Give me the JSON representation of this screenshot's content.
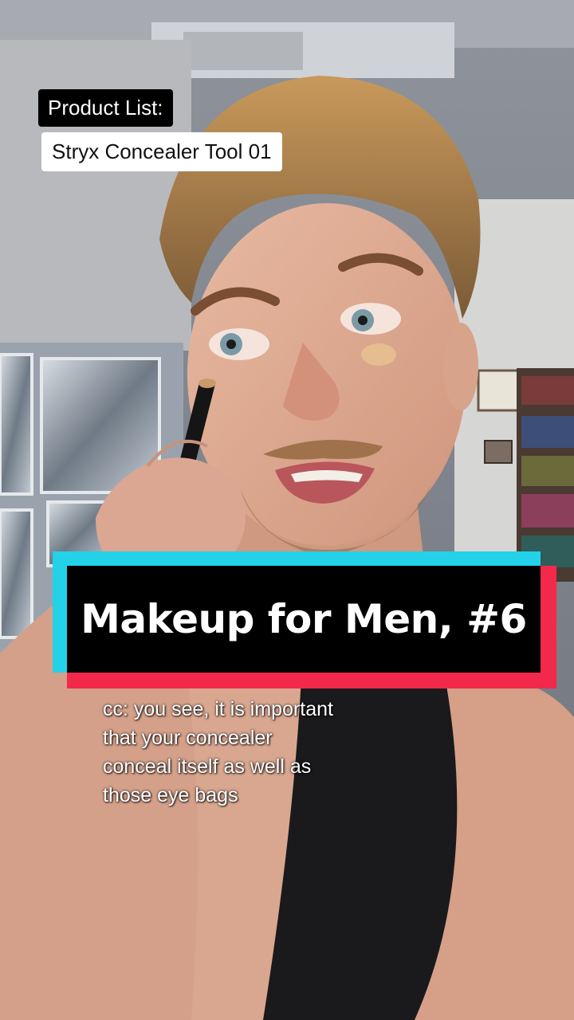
{
  "product_list": {
    "label": "Product List:",
    "items": [
      "Stryx Concealer Tool 01"
    ]
  },
  "title_banner": {
    "text": "Makeup for Men, #6",
    "colors": {
      "cyan": "#23d2e8",
      "pink": "#f2294b",
      "background": "#000000"
    }
  },
  "caption": {
    "lines": [
      "cc: you see, it is important",
      "that your concealer",
      "conceal itself as well as",
      "those eye bags"
    ]
  },
  "scene": {
    "description_icon": "video-frame-person-applying-concealer"
  }
}
